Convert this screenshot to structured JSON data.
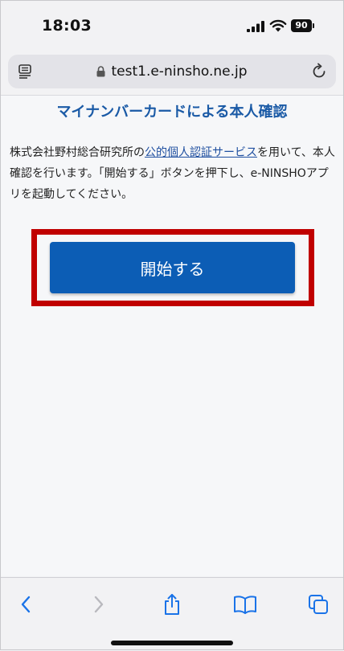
{
  "status_bar": {
    "time": "18:03",
    "battery_level": "90"
  },
  "address_bar": {
    "url": "test1.e-ninsho.ne.jp"
  },
  "page": {
    "title": "マイナンバーカードによる本人確認",
    "description_before_link": "株式会社野村総合研究所の",
    "description_link": "公的個人認証サービス",
    "description_after_link": "を用いて、本人確認を行います。「開始する」ボタンを押下し、e-NINSHOアプリを起動してください。",
    "start_button_label": "開始する"
  },
  "toolbar": {
    "icons": [
      "back-icon",
      "forward-icon",
      "share-icon",
      "bookmarks-icon",
      "tabs-icon"
    ]
  },
  "colors": {
    "accent": "#0c5db5",
    "title": "#1a5aa6",
    "highlight": "#c00000"
  }
}
